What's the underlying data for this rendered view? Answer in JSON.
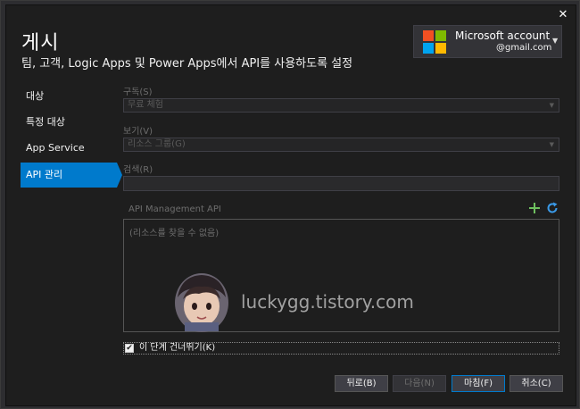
{
  "window": {
    "title": "게시",
    "subtitle": "팀, 고객, Logic Apps 및 Power Apps에서 API를 사용하도록 설정",
    "close_glyph": "✕"
  },
  "account": {
    "name": "Microsoft account",
    "email": "@gmail.com",
    "logo_colors": [
      "#f25022",
      "#7fba00",
      "#00a4ef",
      "#ffb900"
    ]
  },
  "nav": {
    "items": [
      {
        "label": "대상"
      },
      {
        "label": "특정 대상"
      },
      {
        "label": "App Service"
      },
      {
        "label": "API 관리"
      }
    ],
    "active_index": 3,
    "accent_color": "#007acc"
  },
  "form": {
    "subscription_label": "구독(S)",
    "subscription_value": "무료 체험",
    "view_label": "보기(V)",
    "view_value": "리소스 그룹(G)",
    "search_label": "검색(R)",
    "search_value": "",
    "api_section_label": "API Management API",
    "empty_list_text": "(리소스를 찾을 수 없음)",
    "skip_label": "이 단계 건너뛰기(K)",
    "skip_checked": true,
    "add_icon_color": "#6ec05f",
    "refresh_icon_color": "#3a9ae8"
  },
  "watermark": {
    "text": "luckygg.tistory.com"
  },
  "buttons": {
    "back": "뒤로(B)",
    "next": "다음(N)",
    "finish": "마침(F)",
    "cancel": "취소(C)"
  }
}
